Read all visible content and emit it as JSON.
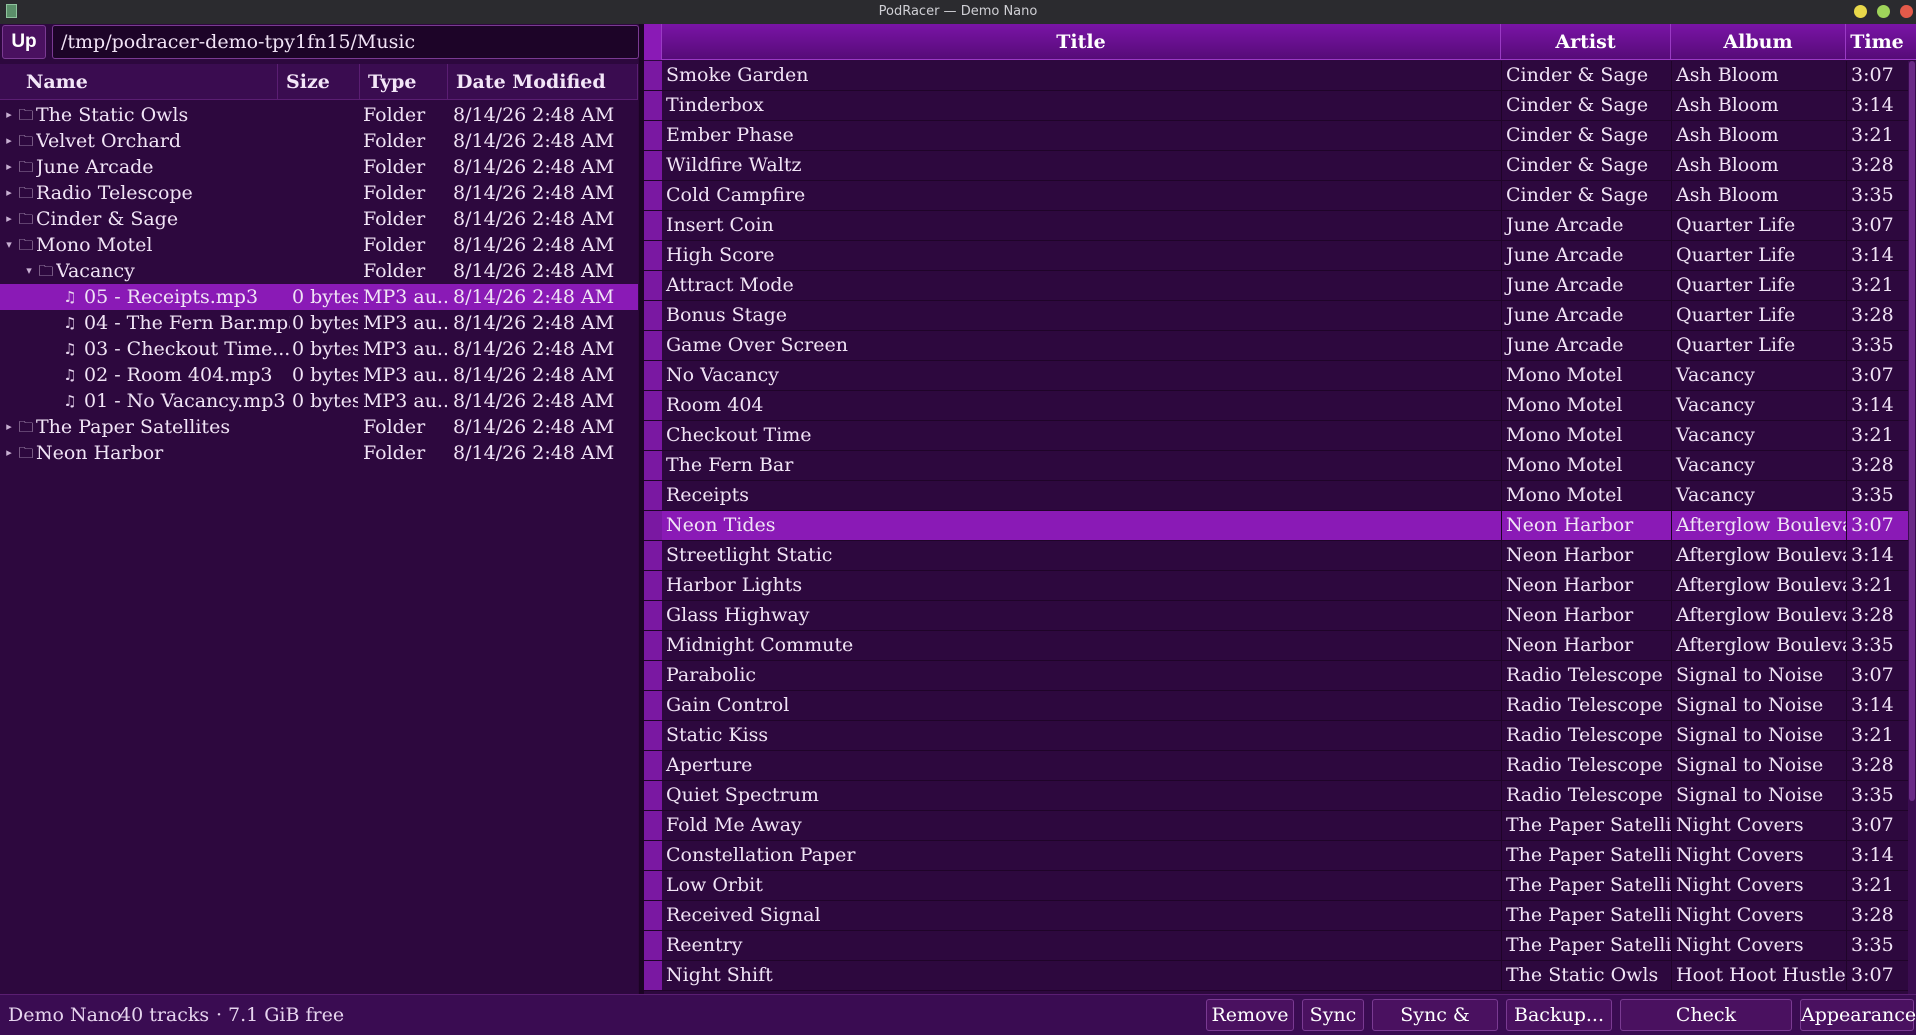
{
  "window": {
    "title": "PodRacer — Demo Nano"
  },
  "browser": {
    "up_label": "Up",
    "path": "/tmp/podracer-demo-tpy1fn15/Music",
    "columns": {
      "name": "Name",
      "size": "Size",
      "type": "Type",
      "date": "Date Modified"
    },
    "rows": [
      {
        "level": 0,
        "arrow": "▸",
        "icon": "folder-icon",
        "name": "The Static Owls",
        "size": "",
        "type": "Folder",
        "date": "8/14/26 2:48 AM"
      },
      {
        "level": 0,
        "arrow": "▸",
        "icon": "folder-icon",
        "name": "Velvet Orchard",
        "size": "",
        "type": "Folder",
        "date": "8/14/26 2:48 AM"
      },
      {
        "level": 0,
        "arrow": "▸",
        "icon": "folder-icon",
        "name": "June Arcade",
        "size": "",
        "type": "Folder",
        "date": "8/14/26 2:48 AM"
      },
      {
        "level": 0,
        "arrow": "▸",
        "icon": "folder-icon",
        "name": "Radio Telescope",
        "size": "",
        "type": "Folder",
        "date": "8/14/26 2:48 AM"
      },
      {
        "level": 0,
        "arrow": "▸",
        "icon": "folder-icon",
        "name": "Cinder & Sage",
        "size": "",
        "type": "Folder",
        "date": "8/14/26 2:48 AM"
      },
      {
        "level": 0,
        "arrow": "▾",
        "icon": "folder-icon",
        "name": "Mono Motel",
        "size": "",
        "type": "Folder",
        "date": "8/14/26 2:48 AM"
      },
      {
        "level": 1,
        "arrow": "▾",
        "icon": "folder-icon",
        "name": "Vacancy",
        "size": "",
        "type": "Folder",
        "date": "8/14/26 2:48 AM"
      },
      {
        "level": 2,
        "arrow": "",
        "icon": "music-note-icon",
        "name": "05 - Receipts.mp3",
        "size": "0 bytes",
        "type": "MP3 au...",
        "date": "8/14/26 2:48 AM",
        "selected": true
      },
      {
        "level": 2,
        "arrow": "",
        "icon": "music-note-icon",
        "name": "04 - The Fern Bar.mp3",
        "size": "0 bytes",
        "type": "MP3 au...",
        "date": "8/14/26 2:48 AM"
      },
      {
        "level": 2,
        "arrow": "",
        "icon": "music-note-icon",
        "name": "03 - Checkout Time....",
        "size": "0 bytes",
        "type": "MP3 au...",
        "date": "8/14/26 2:48 AM"
      },
      {
        "level": 2,
        "arrow": "",
        "icon": "music-note-icon",
        "name": "02 - Room 404.mp3",
        "size": "0 bytes",
        "type": "MP3 au...",
        "date": "8/14/26 2:48 AM"
      },
      {
        "level": 2,
        "arrow": "",
        "icon": "music-note-icon",
        "name": "01 - No Vacancy.mp3",
        "size": "0 bytes",
        "type": "MP3 au...",
        "date": "8/14/26 2:48 AM"
      },
      {
        "level": 0,
        "arrow": "▸",
        "icon": "folder-icon",
        "name": "The Paper Satellites",
        "size": "",
        "type": "Folder",
        "date": "8/14/26 2:48 AM"
      },
      {
        "level": 0,
        "arrow": "▸",
        "icon": "folder-icon",
        "name": "Neon Harbor",
        "size": "",
        "type": "Folder",
        "date": "8/14/26 2:48 AM"
      }
    ]
  },
  "tracks": {
    "columns": {
      "title": "Title",
      "artist": "Artist",
      "album": "Album",
      "time": "Time"
    },
    "rows": [
      {
        "title": "Smoke Garden",
        "artist": "Cinder & Sage",
        "album": "Ash Bloom",
        "time": "3:07"
      },
      {
        "title": "Tinderbox",
        "artist": "Cinder & Sage",
        "album": "Ash Bloom",
        "time": "3:14"
      },
      {
        "title": "Ember Phase",
        "artist": "Cinder & Sage",
        "album": "Ash Bloom",
        "time": "3:21"
      },
      {
        "title": "Wildfire Waltz",
        "artist": "Cinder & Sage",
        "album": "Ash Bloom",
        "time": "3:28"
      },
      {
        "title": "Cold Campfire",
        "artist": "Cinder & Sage",
        "album": "Ash Bloom",
        "time": "3:35"
      },
      {
        "title": "Insert Coin",
        "artist": "June Arcade",
        "album": "Quarter Life",
        "time": "3:07"
      },
      {
        "title": "High Score",
        "artist": "June Arcade",
        "album": "Quarter Life",
        "time": "3:14"
      },
      {
        "title": "Attract Mode",
        "artist": "June Arcade",
        "album": "Quarter Life",
        "time": "3:21"
      },
      {
        "title": "Bonus Stage",
        "artist": "June Arcade",
        "album": "Quarter Life",
        "time": "3:28"
      },
      {
        "title": "Game Over Screen",
        "artist": "June Arcade",
        "album": "Quarter Life",
        "time": "3:35"
      },
      {
        "title": "No Vacancy",
        "artist": "Mono Motel",
        "album": "Vacancy",
        "time": "3:07"
      },
      {
        "title": "Room 404",
        "artist": "Mono Motel",
        "album": "Vacancy",
        "time": "3:14"
      },
      {
        "title": "Checkout Time",
        "artist": "Mono Motel",
        "album": "Vacancy",
        "time": "3:21"
      },
      {
        "title": "The Fern Bar",
        "artist": "Mono Motel",
        "album": "Vacancy",
        "time": "3:28"
      },
      {
        "title": "Receipts",
        "artist": "Mono Motel",
        "album": "Vacancy",
        "time": "3:35"
      },
      {
        "title": "Neon Tides",
        "artist": "Neon Harbor",
        "album": "Afterglow Boulevard",
        "time": "3:07",
        "selected": true
      },
      {
        "title": "Streetlight Static",
        "artist": "Neon Harbor",
        "album": "Afterglow Boulevard",
        "time": "3:14"
      },
      {
        "title": "Harbor Lights",
        "artist": "Neon Harbor",
        "album": "Afterglow Boulevard",
        "time": "3:21"
      },
      {
        "title": "Glass Highway",
        "artist": "Neon Harbor",
        "album": "Afterglow Boulevard",
        "time": "3:28"
      },
      {
        "title": "Midnight Commute",
        "artist": "Neon Harbor",
        "album": "Afterglow Boulevard",
        "time": "3:35"
      },
      {
        "title": "Parabolic",
        "artist": "Radio Telescope",
        "album": "Signal to Noise",
        "time": "3:07"
      },
      {
        "title": "Gain Control",
        "artist": "Radio Telescope",
        "album": "Signal to Noise",
        "time": "3:14"
      },
      {
        "title": "Static Kiss",
        "artist": "Radio Telescope",
        "album": "Signal to Noise",
        "time": "3:21"
      },
      {
        "title": "Aperture",
        "artist": "Radio Telescope",
        "album": "Signal to Noise",
        "time": "3:28"
      },
      {
        "title": "Quiet Spectrum",
        "artist": "Radio Telescope",
        "album": "Signal to Noise",
        "time": "3:35"
      },
      {
        "title": "Fold Me Away",
        "artist": "The Paper Satellites",
        "album": "Night Covers",
        "time": "3:07"
      },
      {
        "title": "Constellation Paper",
        "artist": "The Paper Satellites",
        "album": "Night Covers",
        "time": "3:14"
      },
      {
        "title": "Low Orbit",
        "artist": "The Paper Satellites",
        "album": "Night Covers",
        "time": "3:21"
      },
      {
        "title": "Received Signal",
        "artist": "The Paper Satellites",
        "album": "Night Covers",
        "time": "3:28"
      },
      {
        "title": "Reentry",
        "artist": "The Paper Satellites",
        "album": "Night Covers",
        "time": "3:35"
      },
      {
        "title": "Night Shift",
        "artist": "The Static Owls",
        "album": "Hoot Hoot Hustle",
        "time": "3:07"
      }
    ]
  },
  "status": {
    "device": "Demo Nano",
    "tracks": "40 tracks",
    "separator": "·",
    "free": "7.1 GiB free"
  },
  "buttons": {
    "remove": "Remove",
    "sync": "Sync",
    "sync_eject": "Sync & Eject",
    "backup": "Backup...",
    "check_duplicates": "Check duplicates...",
    "appearance": "Appearance"
  }
}
